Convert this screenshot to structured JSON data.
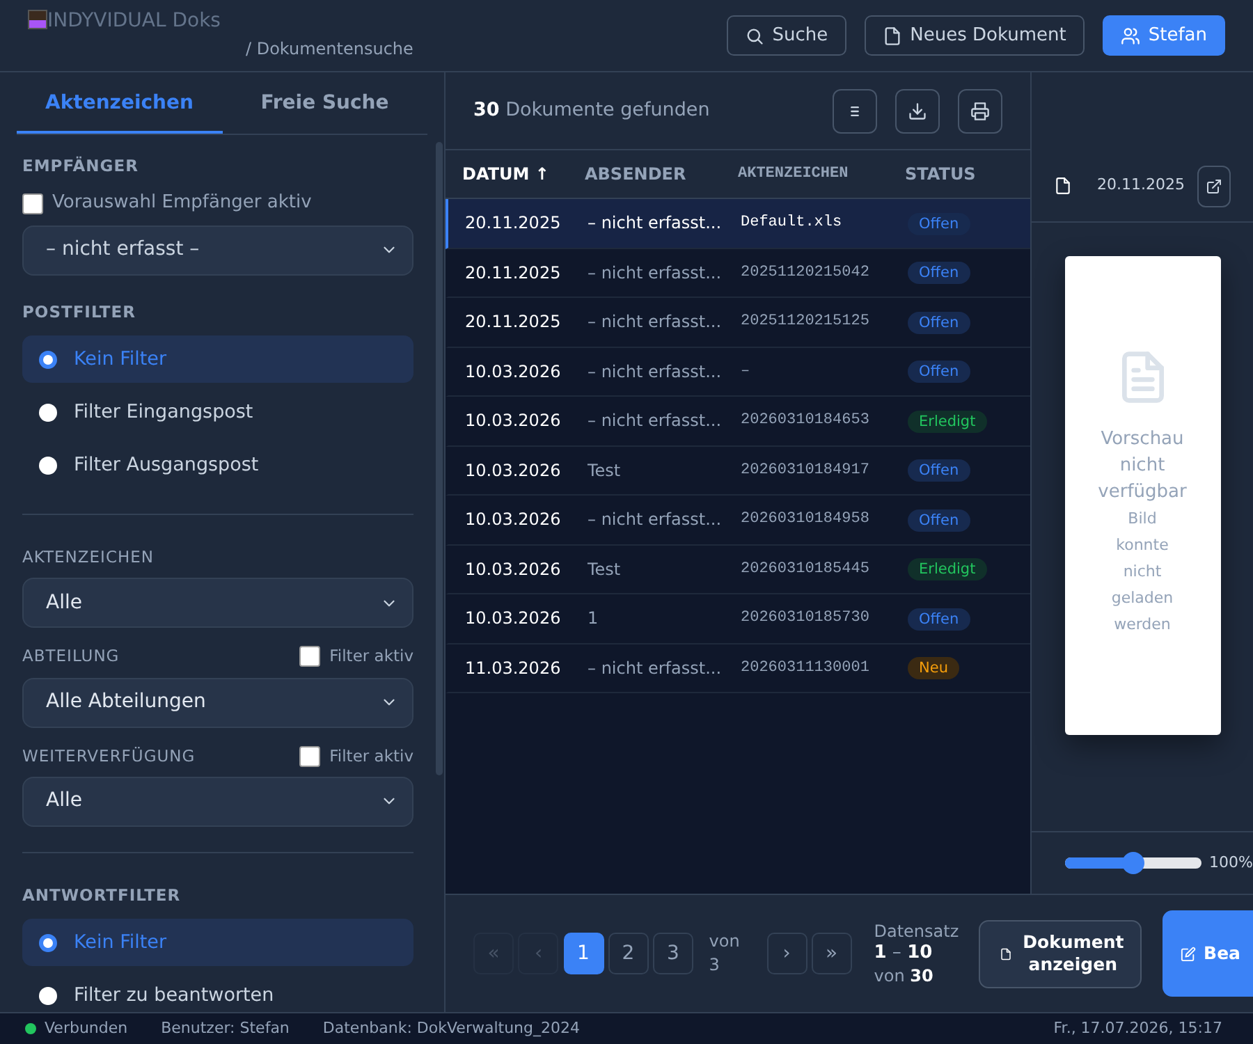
{
  "header": {
    "logo_text": "INDYVIDUAL Doks",
    "breadcrumb": "/ Dokumentensuche",
    "buttons": [
      {
        "label": "Suche",
        "kind": "search",
        "primary": false
      },
      {
        "label": "Neues Dokument",
        "kind": "document",
        "primary": false
      },
      {
        "label": "Stefan",
        "kind": "user",
        "primary": true
      }
    ]
  },
  "sidebar": {
    "tabs": [
      {
        "label": "Aktenzeichen",
        "selected": true
      },
      {
        "label": "Freie Suche",
        "selected": false
      }
    ],
    "sections": [
      {
        "kind": "recipient",
        "heading": "EMPFÄNGER",
        "checkbox": {
          "label": "Vorauswahl Empfänger aktiv",
          "checked": false
        },
        "value": "– nicht erfasst –"
      },
      {
        "kind": "radios",
        "heading": "POSTFILTER",
        "options": [
          {
            "label": "Kein Filter",
            "selected": true
          },
          {
            "label": "Filter Eingangspost",
            "selected": false
          },
          {
            "label": "Filter Ausgangspost",
            "selected": false
          }
        ]
      },
      {
        "kind": "select",
        "divider_before": true,
        "heading": "AKTENZEICHEN",
        "value": "Alle"
      },
      {
        "kind": "select",
        "heading": "ABTEILUNG",
        "filter": {
          "label": "Filter aktiv",
          "checked": false
        },
        "value": "Alle Abteilungen"
      },
      {
        "kind": "select",
        "heading": "WEITERVERFÜGUNG",
        "filter": {
          "label": "Filter aktiv",
          "checked": false
        },
        "value": "Alle"
      },
      {
        "kind": "radios",
        "divider_before": true,
        "heading": "ANTWORTFILTER",
        "options": [
          {
            "label": "Kein Filter",
            "selected": true
          },
          {
            "label": "Filter zu beantworten",
            "selected": false
          }
        ]
      }
    ]
  },
  "results": {
    "summary": "**30** Dokumente gefunden",
    "columns": [
      {
        "label": "DATUM",
        "sort_mark": "↑"
      },
      {
        "label": "ABSENDER"
      },
      {
        "label": "AKTENZEICHEN"
      },
      {
        "label": "STATUS"
      }
    ],
    "rows": [
      {
        "selected": true,
        "date": "20.11.2025",
        "sender": "– nicht erfasst...",
        "reference": "Default.xls",
        "status": {
          "label": "Offen",
          "kind": "open"
        }
      },
      {
        "selected": false,
        "date": "20.11.2025",
        "sender": "– nicht erfasst...",
        "reference": "20251120215042",
        "status": {
          "label": "Offen",
          "kind": "open"
        }
      },
      {
        "selected": false,
        "date": "20.11.2025",
        "sender": "– nicht erfasst...",
        "reference": "20251120215125",
        "status": {
          "label": "Offen",
          "kind": "open"
        }
      },
      {
        "selected": false,
        "date": "10.03.2026",
        "sender": "– nicht erfasst...",
        "reference": "–",
        "status": {
          "label": "Offen",
          "kind": "open"
        }
      },
      {
        "selected": false,
        "date": "10.03.2026",
        "sender": "– nicht erfasst...",
        "reference": "20260310184653",
        "status": {
          "label": "Erledigt",
          "kind": "done"
        }
      },
      {
        "selected": false,
        "date": "10.03.2026",
        "sender": "Test",
        "reference": "20260310184917",
        "status": {
          "label": "Offen",
          "kind": "open"
        }
      },
      {
        "selected": false,
        "date": "10.03.2026",
        "sender": "– nicht erfasst...",
        "reference": "20260310184958",
        "status": {
          "label": "Offen",
          "kind": "open"
        }
      },
      {
        "selected": false,
        "date": "10.03.2026",
        "sender": "Test",
        "reference": "20260310185445",
        "status": {
          "label": "Erledigt",
          "kind": "done"
        }
      },
      {
        "selected": false,
        "date": "10.03.2026",
        "sender": "1",
        "reference": "20260310185730",
        "status": {
          "label": "Offen",
          "kind": "open"
        }
      },
      {
        "selected": false,
        "date": "11.03.2026",
        "sender": "– nicht erfasst...",
        "reference": "20260311130001",
        "status": {
          "label": "Neu",
          "kind": "new"
        }
      }
    ]
  },
  "preview": {
    "date": "20.11.2025",
    "title": "Vorschau nicht verfügbar",
    "message": "Bild konnte nicht geladen werden",
    "zoom": {
      "level": 0.5,
      "reading": "100%"
    }
  },
  "pagination": {
    "first": {
      "label": "«",
      "disabled": true
    },
    "prev": {
      "label": "‹",
      "disabled": true
    },
    "pages": [
      {
        "label": "1",
        "selected": true
      },
      {
        "label": "2",
        "selected": false
      },
      {
        "label": "3",
        "selected": false
      }
    ],
    "of_text": "von 3",
    "next": {
      "label": "›",
      "disabled": false
    },
    "last": {
      "label": "»",
      "disabled": false
    },
    "record_label": "Datensatz",
    "record_range": "**1** – **10**",
    "record_total": "von **30**"
  },
  "actions": [
    {
      "label": "Dokument anzeigen",
      "primary": false
    },
    {
      "label": "Bea",
      "primary": true
    }
  ],
  "status_bar": {
    "connection": {
      "label": "Verbunden",
      "color": "#22c55e"
    },
    "user": "Benutzer: Stefan",
    "database": "Datenbank: DokVerwaltung_2024",
    "datetime": "Fr., 17.07.2026, 15:17"
  }
}
